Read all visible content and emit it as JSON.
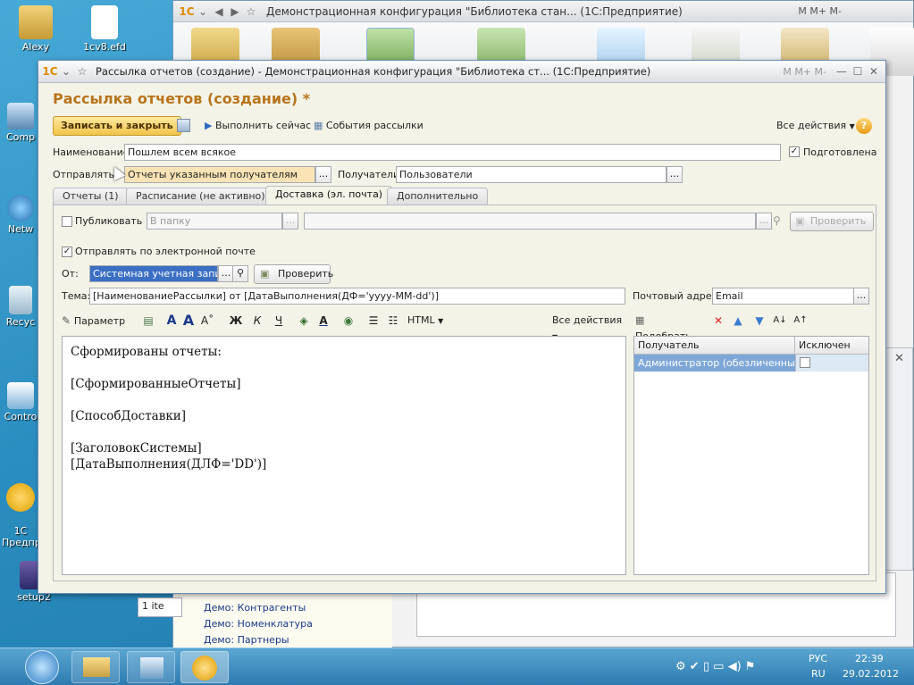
{
  "desktop": {
    "icons": [
      {
        "label": "Alexy"
      },
      {
        "label": "1cv8.efd"
      },
      {
        "label": "Comp"
      },
      {
        "label": "Netw"
      },
      {
        "label": "Recyc"
      },
      {
        "label": "Contro"
      },
      {
        "label": "1С\nПредпр"
      },
      {
        "label": "setup2"
      }
    ]
  },
  "back_window": {
    "title": "Демонстрационная конфигурация \"Библиотека стан... (1С:Предприятие)",
    "toolbar_right": [
      "M",
      "M+",
      "M-"
    ],
    "nav_links": [
      "Демо: Контрагенты",
      "Демо: Номенклатура",
      "Демо: Партнеры"
    ],
    "list_fragment": "1 ite"
  },
  "window": {
    "title": "Рассылка отчетов (создание) - Демонстрационная конфигурация \"Библиотека ст... (1С:Предприятие)",
    "title_right": [
      "M",
      "M+",
      "M-"
    ]
  },
  "form": {
    "title": "Рассылка отчетов (создание) *",
    "toolbar": {
      "save_close": "Записать и закрыть",
      "run_now": "Выполнить сейчас",
      "events": "События рассылки",
      "all_actions": "Все действия",
      "help": "?"
    },
    "name_label": "Наименование:",
    "name_value": "Пошлем всем всякое",
    "prepared_label": "Подготовлена",
    "send_label": "Отправлять:",
    "send_value": "Отчеты указанным получателям",
    "recipients_label": "Получатели:",
    "recipients_value": "Пользователи",
    "tabs": [
      "Отчеты (1)",
      "Расписание (не активно)",
      "Доставка (эл. почта)",
      "Дополнительно"
    ],
    "delivery": {
      "publish_label": "Публиковать",
      "folder_placeholder": "В папку",
      "check_label": "Проверить",
      "email_label": "Отправлять по электронной почте",
      "from_label": "От:",
      "from_value": "Системная учетная запись",
      "verify_label": "Проверить",
      "subject_label": "Тема:",
      "subject_value": "[НаименованиеРассылки] от [ДатаВыполнения(ДФ='yyyy-MM-dd')]",
      "mail_addr_label": "Почтовый адрес:",
      "mail_addr_value": "Email",
      "editor_toolbar": {
        "param": "Параметр",
        "bold": "Ж",
        "italic": "К",
        "underline": "Ч",
        "html": "HTML",
        "all_actions": "Все действия",
        "pick": "Подобрать"
      },
      "body_lines": [
        "Сформированы отчеты:",
        "",
        "[СформированныеОтчеты]",
        "",
        "[СпособДоставки]",
        "",
        "[ЗаголовокСистемы]",
        "[ДатаВыполнения(ДЛФ='DD')]"
      ],
      "grid": {
        "col1": "Получатель",
        "col2": "Исключен",
        "row1": "Администратор (обезличенный ..."
      }
    }
  },
  "taskbar": {
    "lang": "РУС",
    "lang2": "RU",
    "time": "22:39",
    "date": "29.02.2012"
  },
  "colors": {
    "form_title": "#b8741a",
    "primary_button": "#f2c34a",
    "highlight_field": "#fbe3b5",
    "selected_text": "#3a6fc4"
  }
}
